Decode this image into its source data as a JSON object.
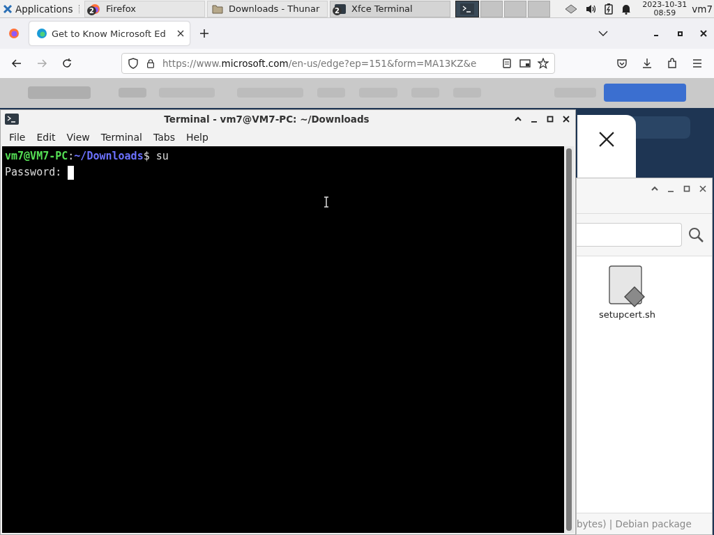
{
  "panel": {
    "app_menu": "Applications",
    "tasks": [
      {
        "label": "Firefox",
        "badge": "2",
        "kind": "browser",
        "selected": false
      },
      {
        "label": "Downloads - Thunar",
        "kind": "folder",
        "selected": false
      },
      {
        "label": "Xfce Terminal",
        "badge": "2",
        "kind": "terminal",
        "selected": true
      }
    ],
    "date": "2023-10-31",
    "time": "08:59",
    "user": "vm7"
  },
  "browser": {
    "tabs": [
      {
        "title": "Get to Know Microsoft Ed",
        "selected": true
      }
    ],
    "url": {
      "scheme": "https://www.",
      "host": "microsoft.com",
      "path": "/en-us/edge?ep=151&form=MA13KZ&e"
    }
  },
  "terminal": {
    "title": "Terminal - vm7@VM7-PC: ~/Downloads",
    "menu": [
      "File",
      "Edit",
      "View",
      "Terminal",
      "Tabs",
      "Help"
    ],
    "lines": [
      {
        "kind": "prompt",
        "user": "vm7@VM7-PC",
        "sep": ":",
        "path": "~/Downloads",
        "command": "$ su"
      },
      {
        "kind": "input",
        "text": "Password: "
      }
    ]
  },
  "file_manager": {
    "files": [
      {
        "name": "setupcert.sh"
      }
    ],
    "status": "bytes)  |  Debian package"
  }
}
